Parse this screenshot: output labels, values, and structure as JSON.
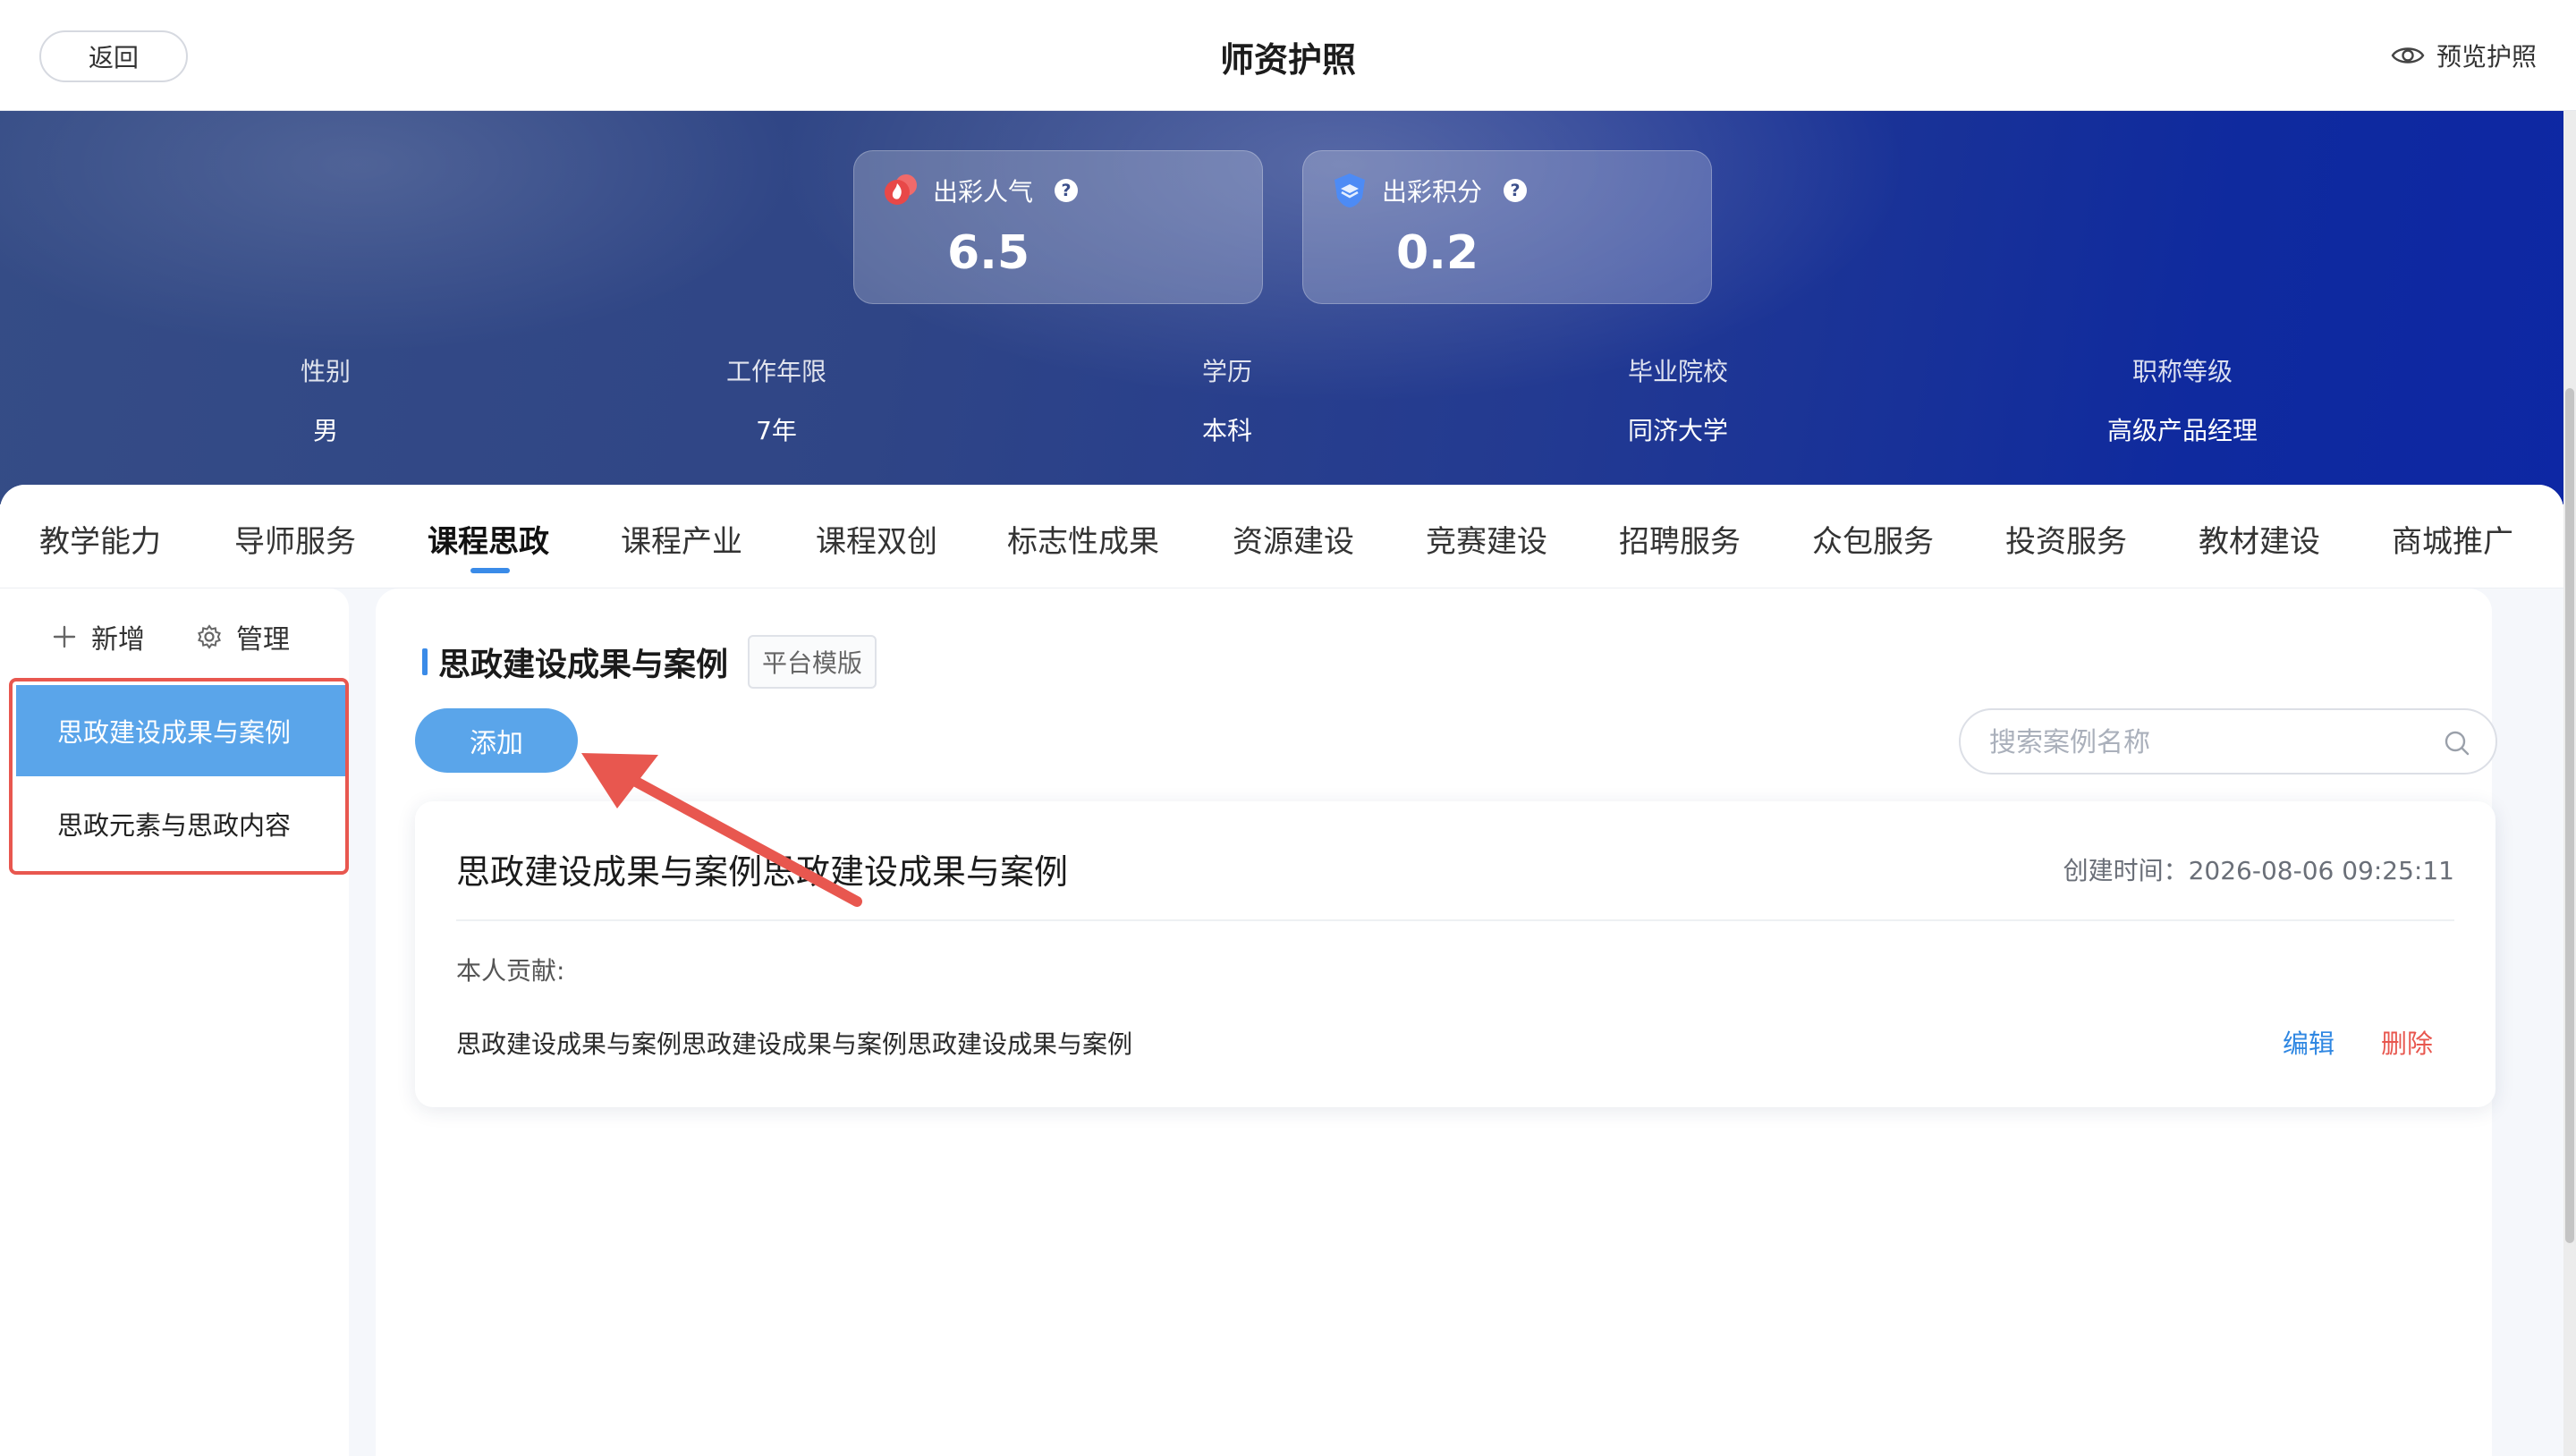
{
  "header": {
    "back_label": "返回",
    "title": "师资护照",
    "preview_label": "预览护照"
  },
  "stats": [
    {
      "label": "出彩人气",
      "value": "6.5",
      "icon": "flame-icon"
    },
    {
      "label": "出彩积分",
      "value": "0.2",
      "icon": "shield-score-icon"
    }
  ],
  "profile": [
    {
      "key": "性别",
      "value": "男"
    },
    {
      "key": "工作年限",
      "value": "7年"
    },
    {
      "key": "学历",
      "value": "本科"
    },
    {
      "key": "毕业院校",
      "value": "同济大学"
    },
    {
      "key": "职称等级",
      "value": "高级产品经理"
    }
  ],
  "tabs": [
    {
      "label": "教学能力"
    },
    {
      "label": "导师服务"
    },
    {
      "label": "课程思政",
      "active": true
    },
    {
      "label": "课程产业"
    },
    {
      "label": "课程双创"
    },
    {
      "label": "标志性成果"
    },
    {
      "label": "资源建设"
    },
    {
      "label": "竞赛建设"
    },
    {
      "label": "招聘服务"
    },
    {
      "label": "众包服务"
    },
    {
      "label": "投资服务"
    },
    {
      "label": "教材建设"
    },
    {
      "label": "商城推广"
    }
  ],
  "sidebar": {
    "add_label": "新增",
    "manage_label": "管理",
    "items": [
      {
        "label": "思政建设成果与案例",
        "selected": true
      },
      {
        "label": "思政元素与思政内容"
      }
    ]
  },
  "main": {
    "section_title": "思政建设成果与案例",
    "template_badge": "平台模版",
    "add_button": "添加",
    "search_placeholder": "搜索案例名称",
    "card": {
      "title": "思政建设成果与案例思政建设成果与案例",
      "created_time": "创建时间：2026-08-06 09:25:11",
      "contribution_label": "本人贡献:",
      "contribution_text": "思政建设成果与案例思政建设成果与案例思政建设成果与案例",
      "edit_label": "编辑",
      "delete_label": "删除"
    }
  },
  "colors": {
    "accent": "#3a8be8",
    "primary_button": "#5aa5ea",
    "danger": "#e8574f",
    "annotation": "#e8574f"
  }
}
